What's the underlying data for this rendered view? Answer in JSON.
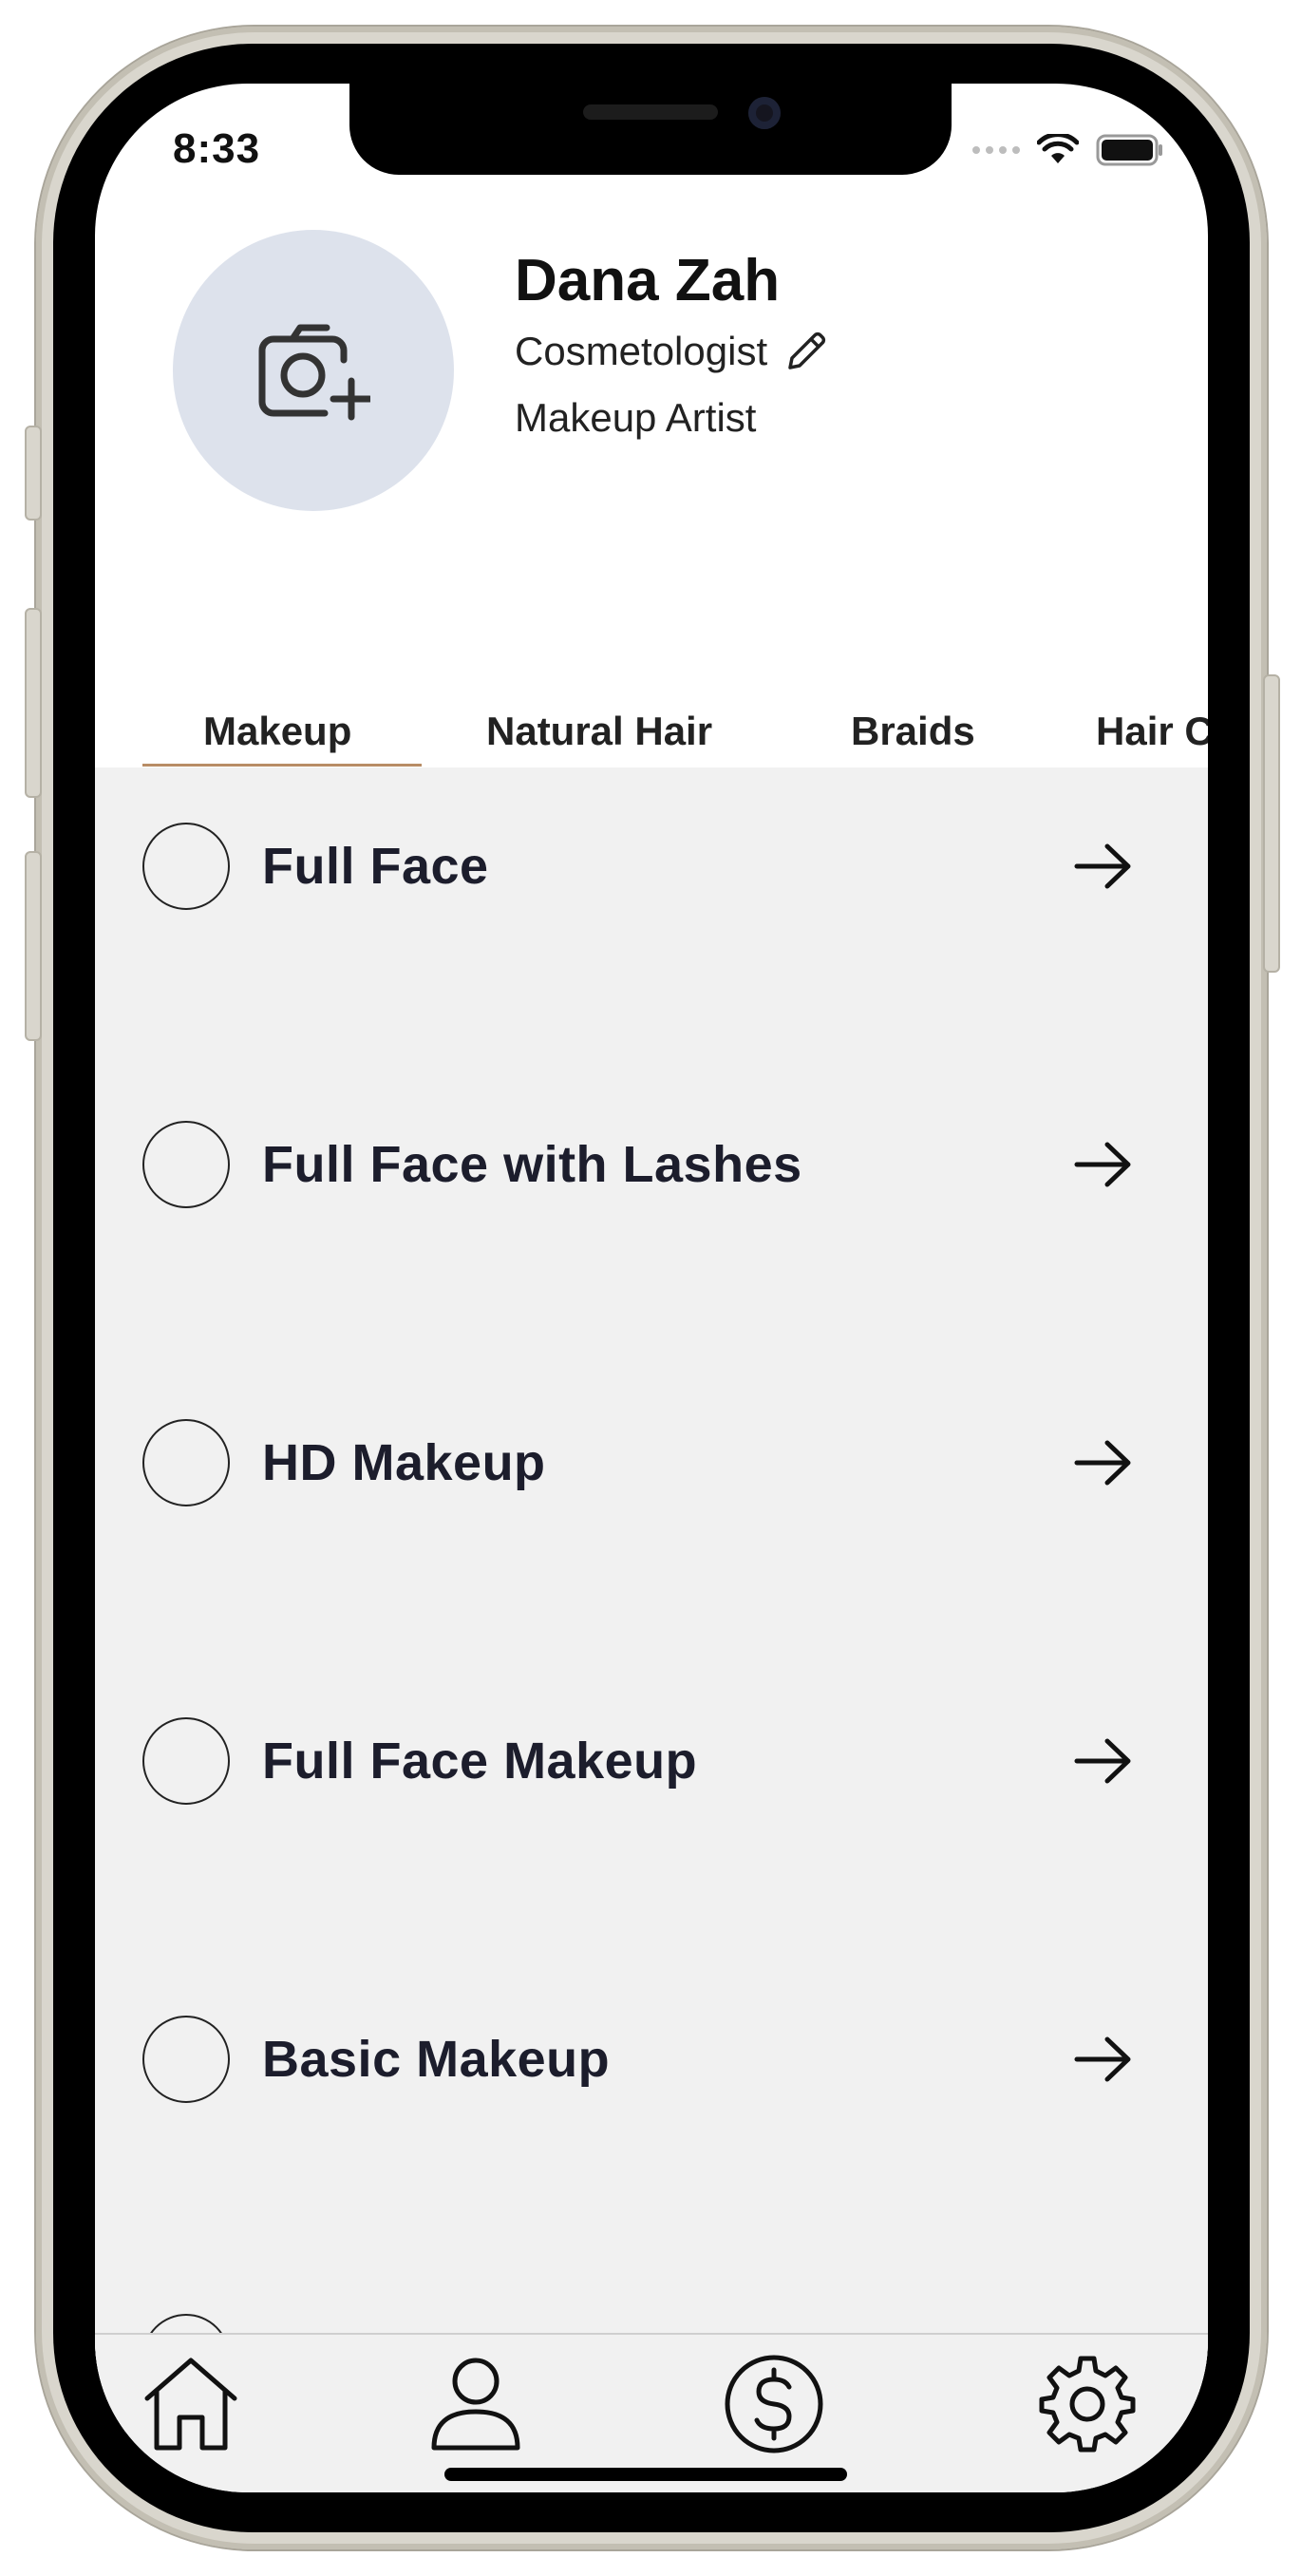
{
  "status_bar": {
    "time": "8:33"
  },
  "profile": {
    "name": "Dana Zah",
    "role": "Cosmetologist",
    "specialty": "Makeup Artist",
    "avatar_icon": "camera-add-icon",
    "edit_icon": "pencil-icon"
  },
  "tabs": [
    {
      "label": "Makeup",
      "selected": true
    },
    {
      "label": "Natural Hair",
      "selected": false
    },
    {
      "label": "Braids",
      "selected": false
    },
    {
      "label": "Hair C",
      "selected": false
    }
  ],
  "services": [
    {
      "label": "Full Face",
      "selected": false
    },
    {
      "label": "Full Face with Lashes",
      "selected": false
    },
    {
      "label": "HD Makeup",
      "selected": false
    },
    {
      "label": "Full Face Makeup",
      "selected": false
    },
    {
      "label": "Basic Makeup",
      "selected": false
    }
  ],
  "bottom_nav": [
    {
      "icon": "home-icon"
    },
    {
      "icon": "person-icon"
    },
    {
      "icon": "dollar-icon"
    },
    {
      "icon": "gear-icon"
    }
  ],
  "colors": {
    "accent_underline": "#b88d66",
    "avatar_bg": "#dde2ec",
    "list_bg": "#f1f1f1",
    "text_dark": "#1c1d2c"
  }
}
